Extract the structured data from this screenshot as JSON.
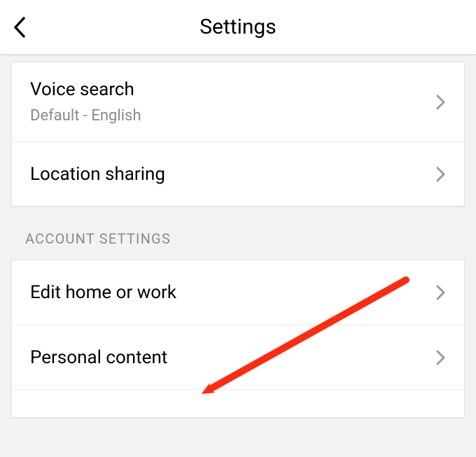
{
  "header": {
    "title": "Settings"
  },
  "group1": {
    "items": [
      {
        "label": "Voice search",
        "sublabel": "Default - English"
      },
      {
        "label": "Location sharing"
      }
    ]
  },
  "section_header": "ACCOUNT SETTINGS",
  "group2": {
    "items": [
      {
        "label": "Edit home or work"
      },
      {
        "label": "Personal content"
      }
    ]
  }
}
